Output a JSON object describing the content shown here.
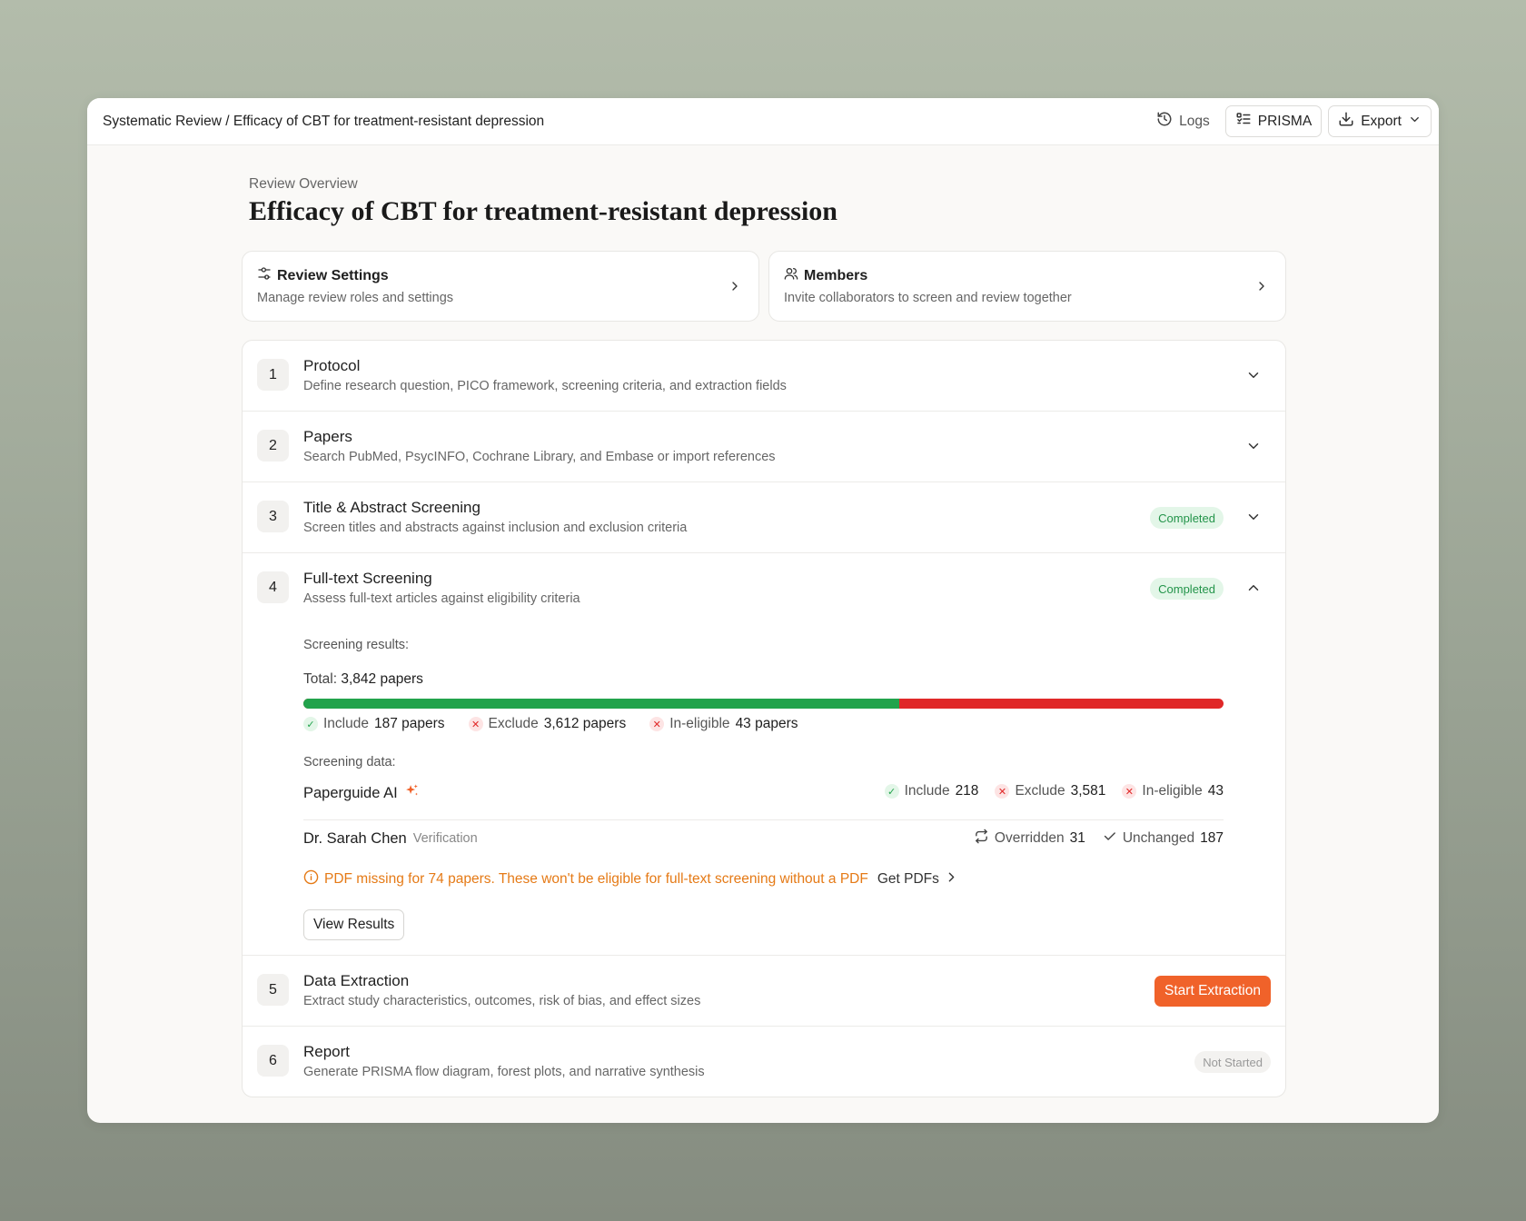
{
  "header": {
    "breadcrumb": "Systematic Review / Efficacy of CBT for treatment-resistant depression",
    "logs_label": "Logs",
    "prisma_label": "PRISMA",
    "export_label": "Export"
  },
  "page": {
    "overline": "Review Overview",
    "title": "Efficacy of CBT for treatment-resistant depression"
  },
  "cards": [
    {
      "title": "Review Settings",
      "desc": "Manage review roles and settings",
      "icon": "sliders-icon"
    },
    {
      "title": "Members",
      "desc": "Invite collaborators to screen and review together",
      "icon": "users-icon"
    }
  ],
  "steps": [
    {
      "num": "1",
      "title": "Protocol",
      "desc": "Define research question, PICO framework, screening criteria, and extraction fields"
    },
    {
      "num": "2",
      "title": "Papers",
      "desc": "Search PubMed, PsycINFO, Cochrane Library, and Embase or import references"
    },
    {
      "num": "3",
      "title": "Title & Abstract Screening",
      "desc": "Screen titles and abstracts against inclusion and exclusion criteria",
      "status": "Completed"
    },
    {
      "num": "4",
      "title": "Full-text Screening",
      "desc": "Assess full-text articles against eligibility criteria",
      "status": "Completed"
    },
    {
      "num": "5",
      "title": "Data Extraction",
      "desc": "Extract study characteristics, outcomes, risk of bias, and effect sizes",
      "action": "Start Extraction"
    },
    {
      "num": "6",
      "title": "Report",
      "desc": "Generate PRISMA flow diagram, forest plots, and narrative synthesis",
      "status": "Not Started"
    }
  ],
  "screening": {
    "results_label": "Screening results:",
    "total_label": "Total:",
    "total_value": "3,842 papers",
    "include_fraction": 0.6475,
    "legend": [
      {
        "label": "Include",
        "value": "187 papers"
      },
      {
        "label": "Exclude",
        "value": "3,612 papers"
      },
      {
        "label": "In-eligible",
        "value": "43 papers"
      }
    ],
    "data_label": "Screening data:",
    "ai": {
      "name": "Paperguide AI",
      "include_label": "Include",
      "include_value": "218",
      "exclude_label": "Exclude",
      "exclude_value": "3,581",
      "ineligible_label": "In-eligible",
      "ineligible_value": "43"
    },
    "human": {
      "name": "Dr. Sarah Chen",
      "role": "Verification",
      "overridden_label": "Overridden",
      "overridden_value": "31",
      "unchanged_label": "Unchanged",
      "unchanged_value": "187"
    },
    "warning": "PDF missing for 74 papers. These won't be eligible for full-text screening without a PDF",
    "warning_link": "Get PDFs",
    "view_results_label": "View Results"
  },
  "colors": {
    "accent": "#f0622a",
    "include": "#22a34c",
    "exclude": "#e02828",
    "warning": "#e57a16"
  }
}
